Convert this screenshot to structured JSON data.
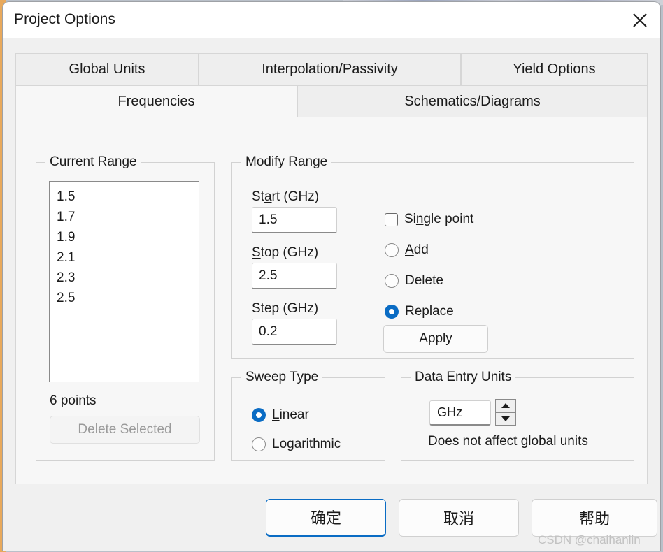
{
  "window": {
    "title": "Project Options",
    "close_icon": "close-icon"
  },
  "tabs": {
    "row1": [
      {
        "label": "Global Units",
        "selected": false
      },
      {
        "label": "Interpolation/Passivity",
        "selected": false
      },
      {
        "label": "Yield Options",
        "selected": false
      }
    ],
    "row2": [
      {
        "label": "Frequencies",
        "selected": true
      },
      {
        "label": "Schematics/Diagrams",
        "selected": false
      }
    ]
  },
  "current_range": {
    "title": "Current Range",
    "items": [
      "1.5",
      "1.7",
      "1.9",
      "2.1",
      "2.3",
      "2.5"
    ],
    "points_label": "6 points",
    "delete_selected_label": "Delete Selected",
    "delete_selected_enabled": false
  },
  "modify_range": {
    "title": "Modify Range",
    "start_label": "Start (GHz)",
    "start_value": "1.5",
    "stop_label": "Stop (GHz)",
    "stop_value": "2.5",
    "step_label": "Step (GHz)",
    "step_value": "0.2",
    "single_point_label": "Single point",
    "single_point_checked": false,
    "add_label": "Add",
    "delete_label": "Delete",
    "replace_label": "Replace",
    "selected_action": "Replace",
    "apply_label": "Apply"
  },
  "sweep_type": {
    "title": "Sweep Type",
    "linear_label": "Linear",
    "logarithmic_label": "Logarithmic",
    "selected": "Linear"
  },
  "data_entry_units": {
    "title": "Data Entry Units",
    "value": "GHz",
    "note": "Does not affect global units",
    "spinner_up_icon": "chevron-up-icon",
    "spinner_down_icon": "chevron-down-icon"
  },
  "buttons": {
    "ok": "确定",
    "cancel": "取消",
    "help": "帮助"
  },
  "watermark": "CSDN @chaihanlin",
  "colors": {
    "accent": "#0a6cc4",
    "dialog_bg": "#f0f0f0",
    "panel_bg": "#f7f7f7",
    "titlebar_bg": "#ffffff"
  }
}
